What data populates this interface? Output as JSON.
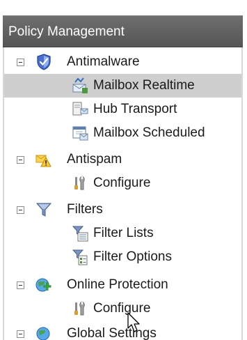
{
  "panel": {
    "title": "Policy Management"
  },
  "tree": {
    "antimalware": {
      "label": "Antimalware",
      "icon": "shield-icon",
      "children": {
        "mailbox_realtime": {
          "label": "Mailbox Realtime",
          "icon": "mailbox-realtime-icon",
          "selected": true
        },
        "hub_transport": {
          "label": "Hub Transport",
          "icon": "hub-transport-icon"
        },
        "mailbox_scheduled": {
          "label": "Mailbox Scheduled",
          "icon": "calendar-icon"
        }
      }
    },
    "antispam": {
      "label": "Antispam",
      "icon": "antispam-warning-icon",
      "children": {
        "configure": {
          "label": "Configure",
          "icon": "wrench-icon"
        }
      }
    },
    "filters": {
      "label": "Filters",
      "icon": "funnel-icon",
      "children": {
        "filter_lists": {
          "label": "Filter Lists",
          "icon": "filter-lists-icon"
        },
        "filter_options": {
          "label": "Filter Options",
          "icon": "filter-options-icon"
        }
      }
    },
    "online_protection": {
      "label": "Online Protection",
      "icon": "globe-plus-icon",
      "children": {
        "configure": {
          "label": "Configure",
          "icon": "wrench-icon"
        }
      }
    },
    "global_settings": {
      "label": "Global Settings",
      "icon": "globe-icon"
    }
  },
  "colors": {
    "header_bg": "#5f5f5f",
    "selected_bg": "#cfcfcf"
  }
}
